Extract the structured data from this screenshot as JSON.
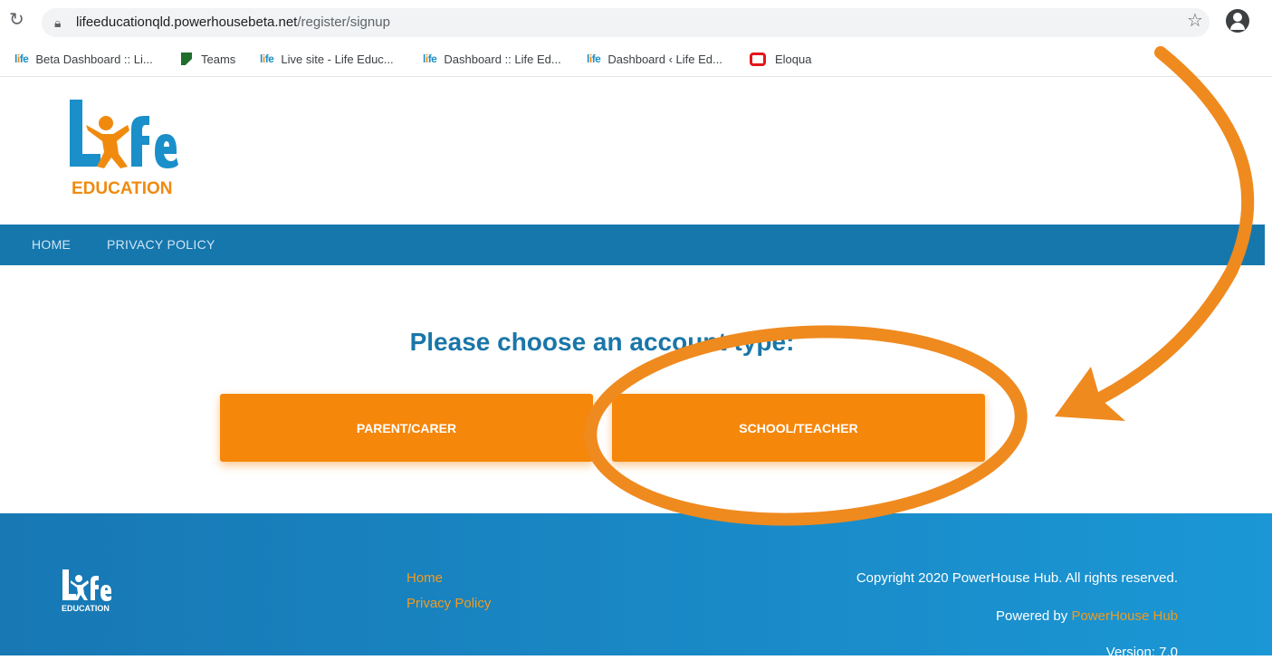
{
  "browser": {
    "url_host": "lifeeducationqld.powerhousebeta.net",
    "url_path": "/register/signup",
    "bookmarks": [
      {
        "label": "Beta Dashboard :: Li...",
        "icon": "life-favicon"
      },
      {
        "label": "Teams",
        "icon": "teams-favicon"
      },
      {
        "label": "Live site - Life Educ...",
        "icon": "life-favicon"
      },
      {
        "label": "Dashboard :: Life Ed...",
        "icon": "life-favicon"
      },
      {
        "label": "Dashboard ‹ Life Ed...",
        "icon": "life-favicon"
      },
      {
        "label": "Eloqua",
        "icon": "eloqua-favicon"
      }
    ],
    "favicon_text": "life"
  },
  "site": {
    "logo": {
      "word": "Life",
      "sub": "EDUCATION"
    },
    "nav": [
      {
        "label": "HOME"
      },
      {
        "label": "PRIVACY POLICY"
      }
    ]
  },
  "main": {
    "heading": "Please choose an account type:",
    "buttons": [
      {
        "label": "PARENT/CARER"
      },
      {
        "label": "SCHOOL/TEACHER"
      }
    ]
  },
  "footer": {
    "logo": {
      "word": "Life",
      "sub": "EDUCATION"
    },
    "links": [
      {
        "label": "Home"
      },
      {
        "label": "Privacy Policy"
      }
    ],
    "copyright": "Copyright 2020 PowerHouse Hub. All rights reserved.",
    "powered_prefix": "Powered by",
    "powered_link": "PowerHouse Hub",
    "version": "Version: 7.0"
  },
  "colors": {
    "brand_blue": "#1677ad",
    "brand_orange": "#f5870b",
    "heading_blue": "#1a76a8",
    "annotation_orange": "#ef8a1f"
  }
}
